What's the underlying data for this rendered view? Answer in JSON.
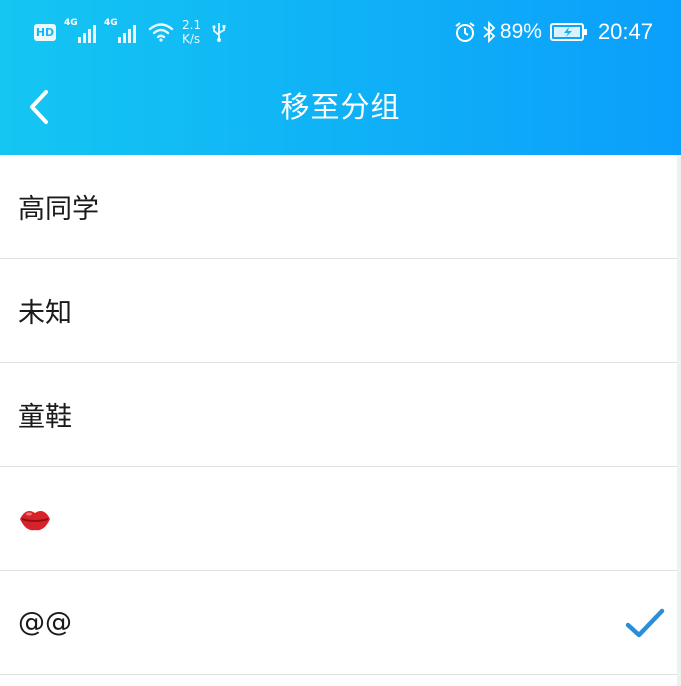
{
  "statusbar": {
    "hd_label": "HD",
    "net1": "4G",
    "net2": "4G",
    "speed_value": "2.1",
    "speed_unit": "K/s",
    "battery_pct": "89%",
    "time": "20:47",
    "icons": [
      "hd-badge",
      "signal",
      "signal",
      "wifi-icon",
      "usb-icon",
      "alarm-icon",
      "bluetooth-icon",
      "battery-charging-icon"
    ]
  },
  "header": {
    "title": "移至分组",
    "back_icon": "chevron-left-icon",
    "gradient": [
      "#14c6f2",
      "#0b9ffb"
    ]
  },
  "groups": [
    {
      "label": "高同学",
      "selected": false
    },
    {
      "label": "未知",
      "selected": false
    },
    {
      "label": "童鞋",
      "selected": false
    },
    {
      "label": "",
      "icon": "kiss-mark-icon",
      "selected": false
    },
    {
      "label": "@@",
      "selected": true
    }
  ],
  "check_icon": "checkmark-icon",
  "check_color": "#2a8fd8"
}
